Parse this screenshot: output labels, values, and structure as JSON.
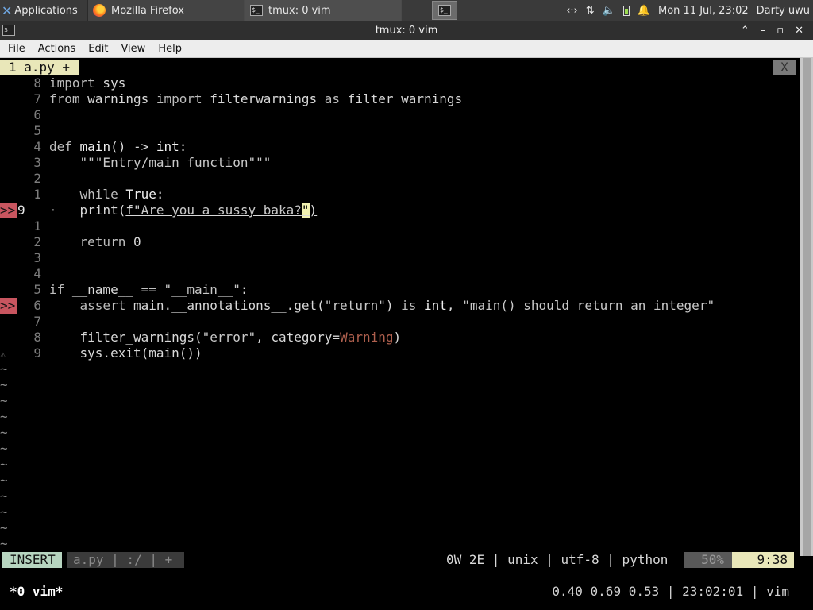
{
  "panel": {
    "applications_label": "Applications",
    "tasks": [
      {
        "label": "Mozilla Firefox"
      },
      {
        "label": "tmux: 0 vim"
      }
    ],
    "clock": "Mon 11 Jul, 23:02",
    "user": "Darty uwu"
  },
  "window": {
    "title": "tmux: 0 vim"
  },
  "menubar": {
    "items": [
      "File",
      "Actions",
      "Edit",
      "View",
      "Help"
    ]
  },
  "vim": {
    "tab_label": "1 a.py +",
    "tab_close": "X",
    "cursor_char": "\"",
    "status": {
      "mode": "INSERT",
      "file": "a.py | :/ | +",
      "right": "0W 2E | unix | utf-8 | python",
      "percent": "50%",
      "position": "9:38"
    },
    "tildes": 12
  },
  "tmux": {
    "window": "*0 vim*",
    "right": "0.40 0.69 0.53 | 23:02:01 | vim"
  }
}
